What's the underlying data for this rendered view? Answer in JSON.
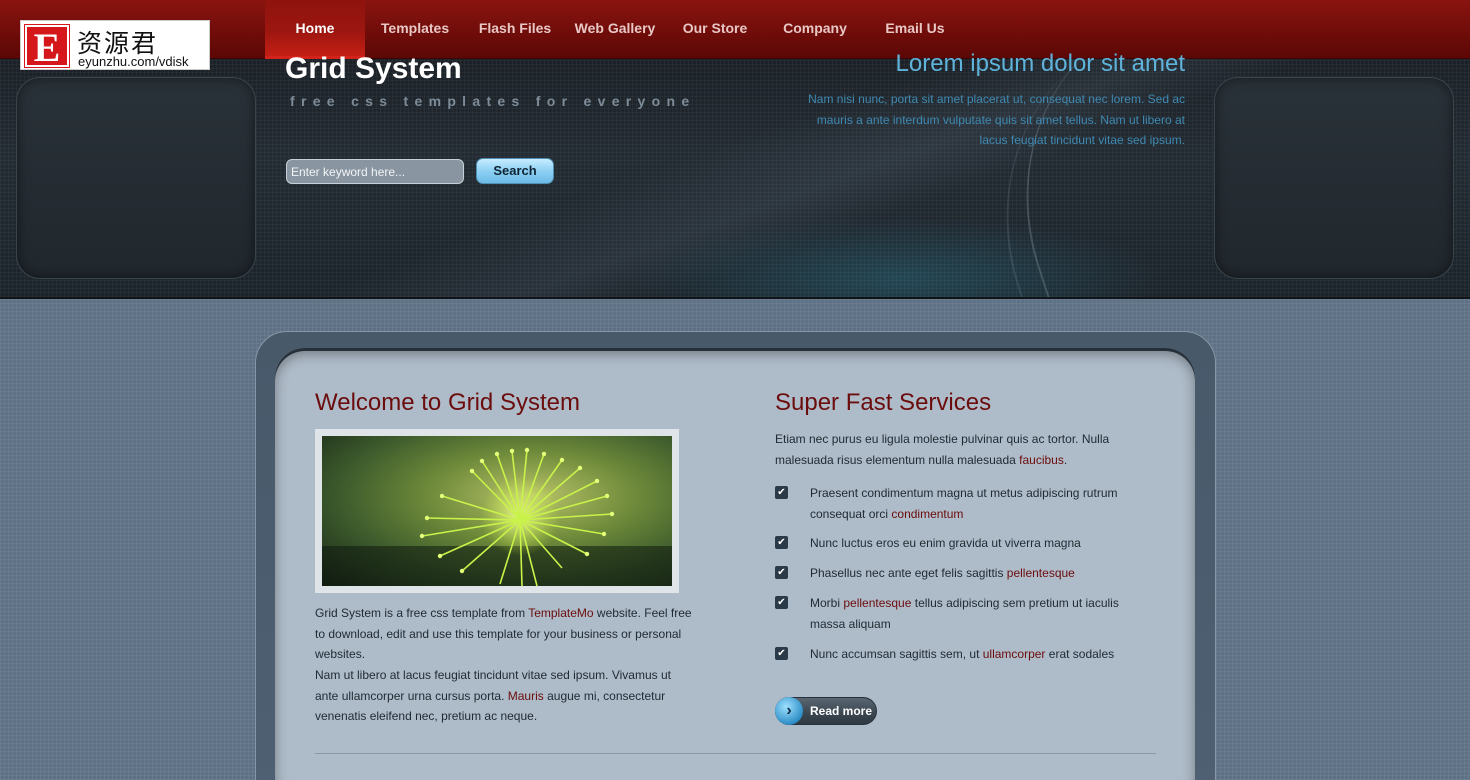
{
  "logo": {
    "mark": "E",
    "chinese": "资源君",
    "url": "eyunzhu.com/vdisk"
  },
  "nav": {
    "items": [
      {
        "label": "Home",
        "active": true
      },
      {
        "label": "Templates",
        "active": false
      },
      {
        "label": "Flash Files",
        "active": false
      },
      {
        "label": "Web Gallery",
        "active": false
      },
      {
        "label": "Our Store",
        "active": false
      },
      {
        "label": "Company",
        "active": false
      },
      {
        "label": "Email Us",
        "active": false
      }
    ]
  },
  "header": {
    "title": "Grid System",
    "tagline": "free css templates for everyone",
    "search": {
      "placeholder": "Enter keyword here...",
      "button_label": "Search"
    },
    "banner_heading": "Lorem ipsum dolor sit amet",
    "banner_text": "Nam nisi nunc, porta sit amet placerat ut, consequat nec lorem. Sed ac mauris a ante interdum vulputate quis sit amet tellus. Nam ut libero at lacus feugiat tincidunt vitae sed ipsum."
  },
  "welcome": {
    "title": "Welcome to Grid System",
    "image_alt": "green dandelion-like plant",
    "p1_before": "Grid System is a free css template from ",
    "p1_link": "TemplateMo",
    "p1_after": " website. Feel free to download, edit and use this template for your business or personal websites.",
    "p2_before": "Nam ut libero at lacus feugiat tincidunt vitae sed ipsum. Vivamus ut ante ullamcorper urna cursus porta. ",
    "p2_link": "Mauris",
    "p2_after": " augue mi, consectetur venenatis eleifend nec, pretium ac neque."
  },
  "services": {
    "title": "Super Fast Services",
    "intro_before": "Etiam nec purus eu ligula molestie pulvinar quis ac tortor. Nulla malesuada risus elementum nulla malesuada ",
    "intro_link": "faucibus",
    "intro_after": ".",
    "items": [
      {
        "before": "Praesent condimentum magna ut metus adipiscing rutrum consequat orci ",
        "link": "condimentum",
        "after": ""
      },
      {
        "before": "Nunc luctus eros eu enim gravida ut viverra magna",
        "link": "",
        "after": ""
      },
      {
        "before": "Phasellus nec ante eget felis sagittis ",
        "link": "pellentesque",
        "after": ""
      },
      {
        "before": "Morbi ",
        "link": "pellentesque",
        "after": " tellus adipiscing sem pretium ut iaculis massa aliquam"
      },
      {
        "before": "Nunc accumsan sagittis sem, ut ",
        "link": "ullamcorper",
        "after": " erat sodales"
      }
    ],
    "read_more_label": "Read more"
  },
  "colors": {
    "nav_red": "#7a0f0b",
    "heading_dark_red": "#6b0d0d",
    "banner_blue": "#5fb3da",
    "content_bg": "#aebbc8"
  }
}
